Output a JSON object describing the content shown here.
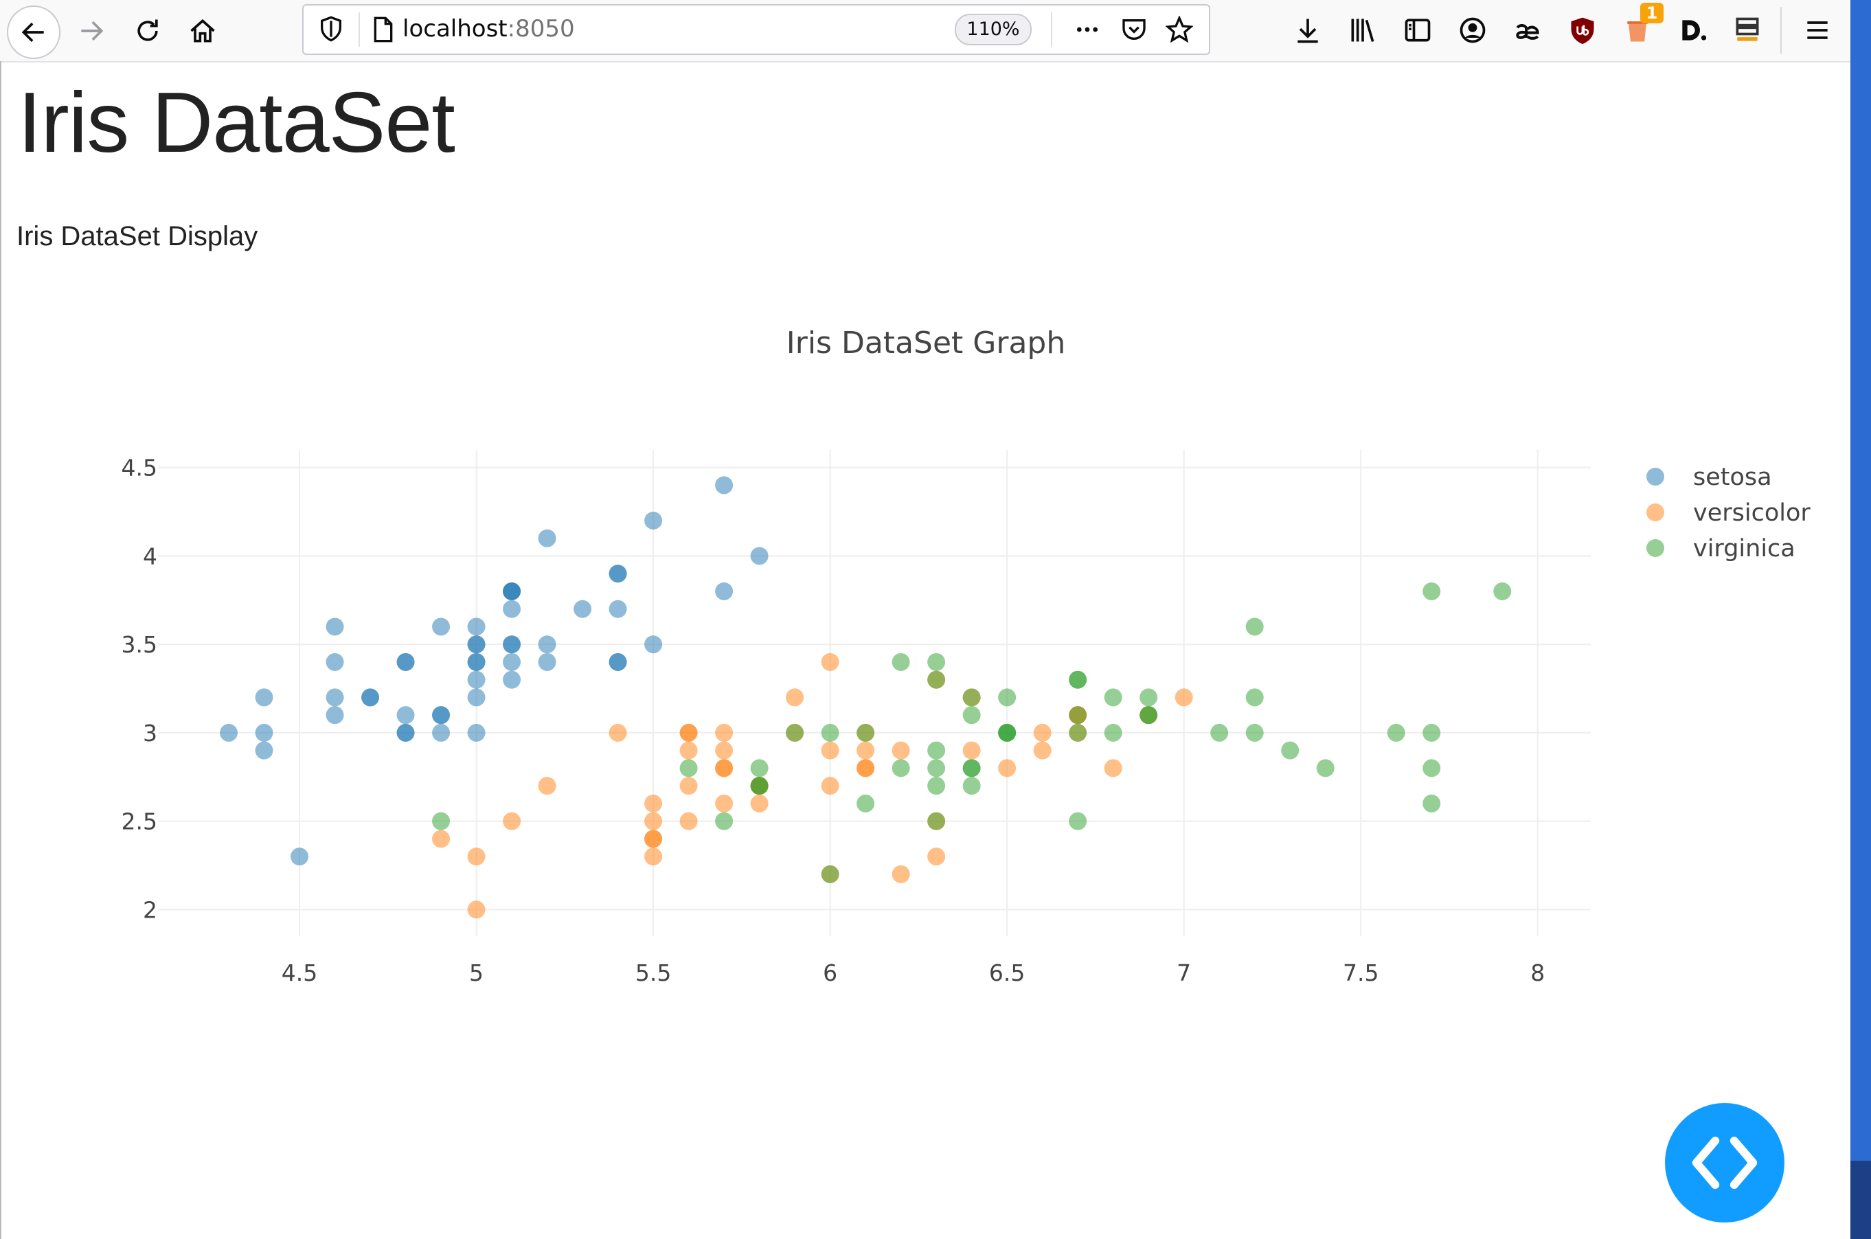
{
  "browser": {
    "url_host": "localhost",
    "url_port": ":8050",
    "zoom_level": "110%",
    "notification_count": "1"
  },
  "page": {
    "title": "Iris DataSet",
    "subtitle": "Iris DataSet Display"
  },
  "colors": {
    "setosa": "#1f77b4",
    "versicolor": "#ff7f0e",
    "virginica": "#2ca02c",
    "grid": "#eeeeee",
    "fab": "#119dff"
  },
  "chart_data": {
    "type": "scatter",
    "title": "Iris DataSet Graph",
    "xlabel": "",
    "ylabel": "",
    "xlim": [
      4.1,
      8.15
    ],
    "ylim": [
      1.85,
      4.6
    ],
    "x_ticks": [
      "4.5",
      "5",
      "5.5",
      "6",
      "6.5",
      "7",
      "7.5",
      "8"
    ],
    "y_ticks": [
      "2",
      "2.5",
      "3",
      "3.5",
      "4",
      "4.5"
    ],
    "grid": true,
    "legend_position": "top-right",
    "series": [
      {
        "name": "setosa",
        "x": [
          5.1,
          4.9,
          4.7,
          4.6,
          5.0,
          5.4,
          4.6,
          5.0,
          4.4,
          4.9,
          5.4,
          4.8,
          4.8,
          4.3,
          5.8,
          5.7,
          5.4,
          5.1,
          5.7,
          5.1,
          5.4,
          5.1,
          4.6,
          5.1,
          4.8,
          5.0,
          5.0,
          5.2,
          5.2,
          4.7,
          4.8,
          5.4,
          5.2,
          5.5,
          4.9,
          5.0,
          5.5,
          4.9,
          4.4,
          5.1,
          5.0,
          4.5,
          4.4,
          5.0,
          5.1,
          4.8,
          5.1,
          4.6,
          5.3,
          5.0
        ],
        "y": [
          3.5,
          3.0,
          3.2,
          3.1,
          3.6,
          3.9,
          3.4,
          3.4,
          2.9,
          3.1,
          3.7,
          3.4,
          3.0,
          3.0,
          4.0,
          4.4,
          3.9,
          3.5,
          3.8,
          3.8,
          3.4,
          3.7,
          3.6,
          3.3,
          3.4,
          3.0,
          3.4,
          3.5,
          3.4,
          3.2,
          3.1,
          3.4,
          4.1,
          4.2,
          3.1,
          3.2,
          3.5,
          3.6,
          3.0,
          3.4,
          3.5,
          2.3,
          3.2,
          3.5,
          3.8,
          3.0,
          3.8,
          3.2,
          3.7,
          3.3
        ]
      },
      {
        "name": "versicolor",
        "x": [
          7.0,
          6.4,
          6.9,
          5.5,
          6.5,
          5.7,
          6.3,
          4.9,
          6.6,
          5.2,
          5.0,
          5.9,
          6.0,
          6.1,
          5.6,
          6.7,
          5.6,
          5.8,
          6.2,
          5.6,
          5.9,
          6.1,
          6.3,
          6.1,
          6.4,
          6.6,
          6.8,
          6.7,
          6.0,
          5.7,
          5.5,
          5.5,
          5.8,
          6.0,
          5.4,
          6.0,
          6.7,
          6.3,
          5.6,
          5.5,
          5.5,
          6.1,
          5.8,
          5.0,
          5.6,
          5.7,
          5.7,
          6.2,
          5.1,
          5.7
        ],
        "y": [
          3.2,
          3.2,
          3.1,
          2.3,
          2.8,
          2.8,
          3.3,
          2.4,
          2.9,
          2.7,
          2.0,
          3.0,
          2.2,
          2.9,
          2.9,
          3.1,
          3.0,
          2.7,
          2.2,
          2.5,
          3.2,
          2.8,
          2.5,
          2.8,
          2.9,
          3.0,
          2.8,
          3.0,
          2.9,
          2.6,
          2.4,
          2.4,
          2.7,
          2.7,
          3.0,
          3.4,
          3.1,
          2.3,
          3.0,
          2.5,
          2.6,
          3.0,
          2.6,
          2.3,
          2.7,
          3.0,
          2.9,
          2.9,
          2.5,
          2.8
        ]
      },
      {
        "name": "virginica",
        "x": [
          6.3,
          5.8,
          7.1,
          6.3,
          6.5,
          7.6,
          4.9,
          7.3,
          6.7,
          7.2,
          6.5,
          6.4,
          6.8,
          5.7,
          5.8,
          6.4,
          6.5,
          7.7,
          7.7,
          6.0,
          6.9,
          5.6,
          7.7,
          6.3,
          6.7,
          7.2,
          6.2,
          6.1,
          6.4,
          7.2,
          7.4,
          7.9,
          6.4,
          6.3,
          6.1,
          7.7,
          6.3,
          6.4,
          6.0,
          6.9,
          6.7,
          6.9,
          5.8,
          6.8,
          6.7,
          6.7,
          6.3,
          6.5,
          6.2,
          5.9
        ],
        "y": [
          3.3,
          2.7,
          3.0,
          2.9,
          3.0,
          3.0,
          2.5,
          2.9,
          2.5,
          3.6,
          3.2,
          2.7,
          3.0,
          2.5,
          2.8,
          3.2,
          3.0,
          3.8,
          2.6,
          2.2,
          3.2,
          2.8,
          2.8,
          2.7,
          3.3,
          3.2,
          2.8,
          3.0,
          2.8,
          3.0,
          2.8,
          3.8,
          2.8,
          2.8,
          2.6,
          3.0,
          3.4,
          3.1,
          3.0,
          3.1,
          3.1,
          3.1,
          2.7,
          3.2,
          3.3,
          3.0,
          2.5,
          3.0,
          3.4,
          3.0
        ]
      }
    ]
  }
}
